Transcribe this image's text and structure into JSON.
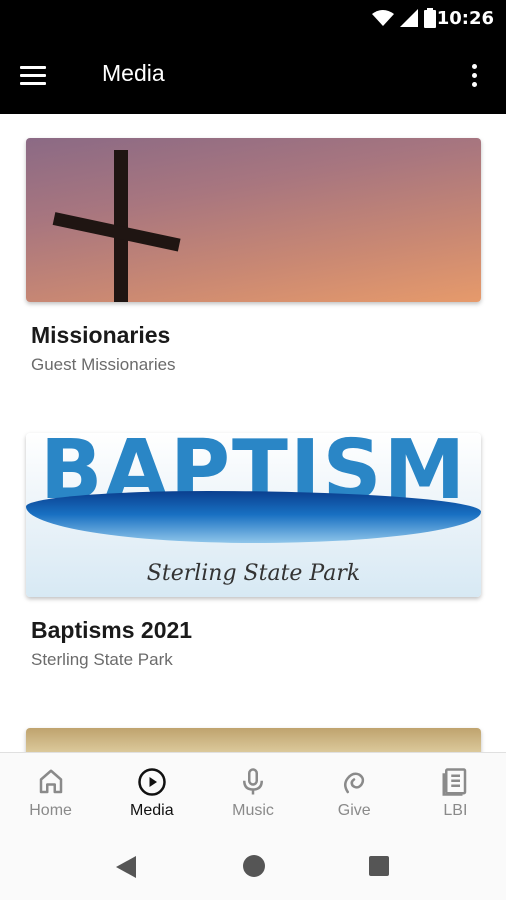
{
  "status": {
    "time": "10:26"
  },
  "app_bar": {
    "title": "Media"
  },
  "cards": [
    {
      "title": "Missionaries",
      "subtitle": "Guest Missionaries"
    },
    {
      "title": "Baptisms 2021",
      "subtitle": "Sterling State Park",
      "image_word": "BAPTISM",
      "image_caption": "Sterling State Park"
    }
  ],
  "bottom_nav": [
    {
      "label": "Home",
      "icon": "home-icon",
      "active": false
    },
    {
      "label": "Media",
      "icon": "play-circle-icon",
      "active": true
    },
    {
      "label": "Music",
      "icon": "microphone-icon",
      "active": false
    },
    {
      "label": "Give",
      "icon": "give-icon",
      "active": false
    },
    {
      "label": "LBI",
      "icon": "book-icon",
      "active": false
    }
  ],
  "colors": {
    "app_bar": "#000000",
    "inactive_nav": "#8a8a8a",
    "active_nav": "#111111"
  }
}
